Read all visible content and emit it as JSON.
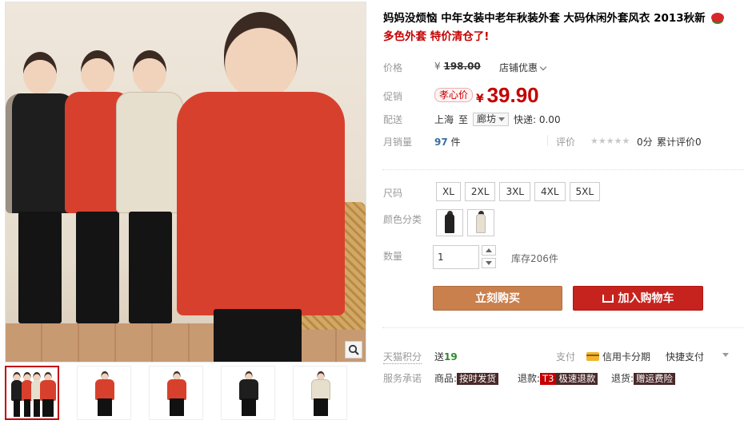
{
  "product": {
    "title_main": "妈妈没烦恼 中年女装中老年秋装外套 大码休闲外套风衣 2013秋新",
    "title_sub": "多色外套 特价清仓了!"
  },
  "pricing": {
    "price_label": "价格",
    "original_symbol": "¥",
    "original_price": "198.00",
    "shop_promo": "店铺优惠",
    "promo_label": "促销",
    "promo_badge": "孝心价",
    "promo_symbol": "¥",
    "promo_price": "39.90"
  },
  "shipping": {
    "label": "配送",
    "from": "上海",
    "to_word": "至",
    "destination": "廊坊",
    "express": "快递: 0.00"
  },
  "sales": {
    "label": "月销量",
    "count": "97",
    "unit": "件",
    "review_label": "评价",
    "stars": "★★★★★",
    "score": "0分",
    "cumulative": "累计评价0"
  },
  "size": {
    "label": "尺码",
    "options": [
      "XL",
      "2XL",
      "3XL",
      "4XL",
      "5XL"
    ]
  },
  "color": {
    "label": "颜色分类",
    "swatches": [
      {
        "name": "black-coat",
        "color": "#222222"
      },
      {
        "name": "beige-coat",
        "color": "#e8e0cf"
      }
    ]
  },
  "quantity": {
    "label": "数量",
    "value": "1",
    "stock": "库存206件"
  },
  "actions": {
    "buy_now": "立刻购买",
    "add_to_cart": "加入购物车"
  },
  "rewards": {
    "label": "天猫积分",
    "give_word": "送",
    "points": "19",
    "pay_label": "支付",
    "credit_installment": "信用卡分期",
    "quick_pay": "快捷支付"
  },
  "service": {
    "label": "服务承诺",
    "goods_label": "商品:",
    "goods_tag": "按时发货",
    "refund_label": "退款:",
    "refund_t3": "T3",
    "refund_tag": "极速退款",
    "return_label": "退货:",
    "return_tag": "赠运费险"
  },
  "colors": {
    "accent_red": "#c40000",
    "buy_button": "#c9804d",
    "cart_button": "#c7231e",
    "coat_red": "#d8402e",
    "coat_black": "#1e1e1e",
    "coat_beige": "#e7dfcd"
  }
}
